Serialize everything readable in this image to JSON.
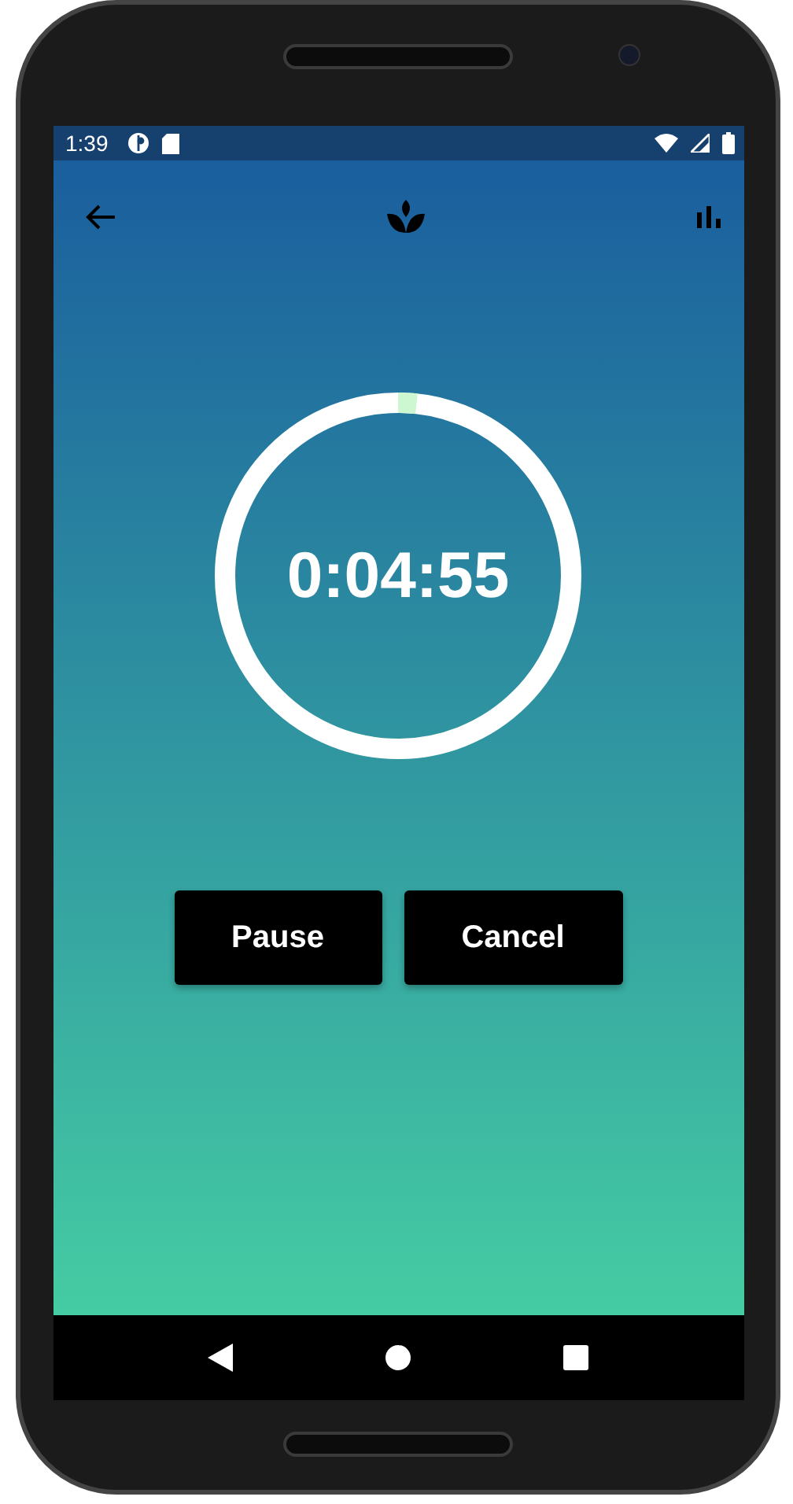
{
  "status_bar": {
    "time": "1:39"
  },
  "timer": {
    "remaining": "0:04:55"
  },
  "buttons": [
    {
      "label": "Pause"
    },
    {
      "label": "Cancel"
    }
  ]
}
